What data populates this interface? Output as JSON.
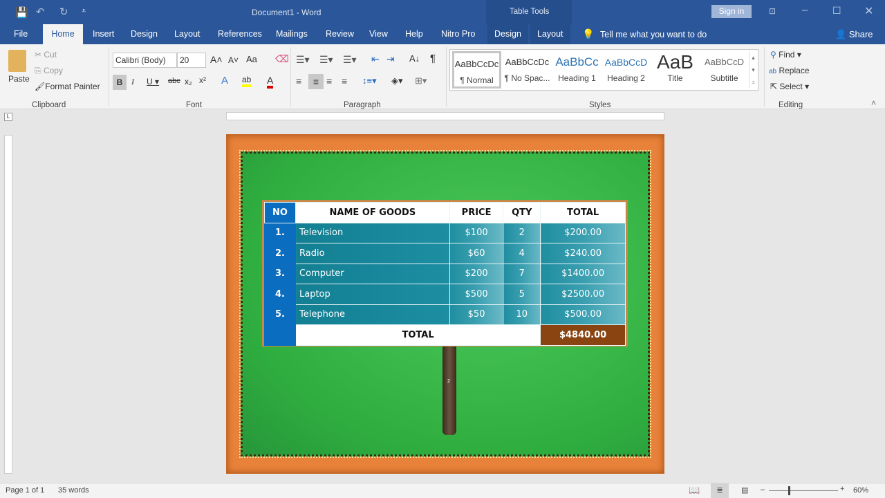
{
  "titlebar": {
    "document_title": "Document1 - Word",
    "contextual_group": "Table Tools",
    "sign_in": "Sign in"
  },
  "tabs": [
    "File",
    "Home",
    "Insert",
    "Design",
    "Layout",
    "References",
    "Mailings",
    "Review",
    "View",
    "Help",
    "Nitro Pro",
    "Design",
    "Layout"
  ],
  "tell_me": "Tell me what you want to do",
  "share": "Share",
  "clipboard": {
    "paste": "Paste",
    "cut": "Cut",
    "copy": "Copy",
    "format_painter": "Format Painter",
    "label": "Clipboard"
  },
  "font": {
    "name": "Calibri (Body)",
    "size": "20",
    "case": "Aa",
    "label": "Font"
  },
  "paragraph": {
    "label": "Paragraph"
  },
  "styles": {
    "label": "Styles",
    "items": [
      {
        "preview": "AaBbCcDc",
        "name": "¶ Normal"
      },
      {
        "preview": "AaBbCcDc",
        "name": "¶ No Spac..."
      },
      {
        "preview": "AaBbCc",
        "name": "Heading 1"
      },
      {
        "preview": "AaBbCcD",
        "name": "Heading 2"
      },
      {
        "preview": "AaB",
        "name": "Title"
      },
      {
        "preview": "AaBbCcD",
        "name": "Subtitle"
      }
    ]
  },
  "editing": {
    "find": "Find",
    "replace": "Replace",
    "select": "Select",
    "label": "Editing"
  },
  "table": {
    "headers": [
      "NO",
      "NAME OF GOODS",
      "PRICE",
      "QTY",
      "TOTAL"
    ],
    "rows": [
      [
        "1.",
        "Television",
        "$100",
        "2",
        "$200.00"
      ],
      [
        "2.",
        "Radio",
        "$60",
        "4",
        "$240.00"
      ],
      [
        "3.",
        "Computer",
        "$200",
        "7",
        "$1400.00"
      ],
      [
        "4.",
        "Laptop",
        "$500",
        "5",
        "$2500.00"
      ],
      [
        "5.",
        "Telephone",
        "$50",
        "10",
        "$500.00"
      ]
    ],
    "total_label": "TOTAL",
    "grand_total": "$4840.00"
  },
  "post_label": "2",
  "status": {
    "page": "Page 1 of 1",
    "words": "35 words",
    "zoom": "60%"
  }
}
